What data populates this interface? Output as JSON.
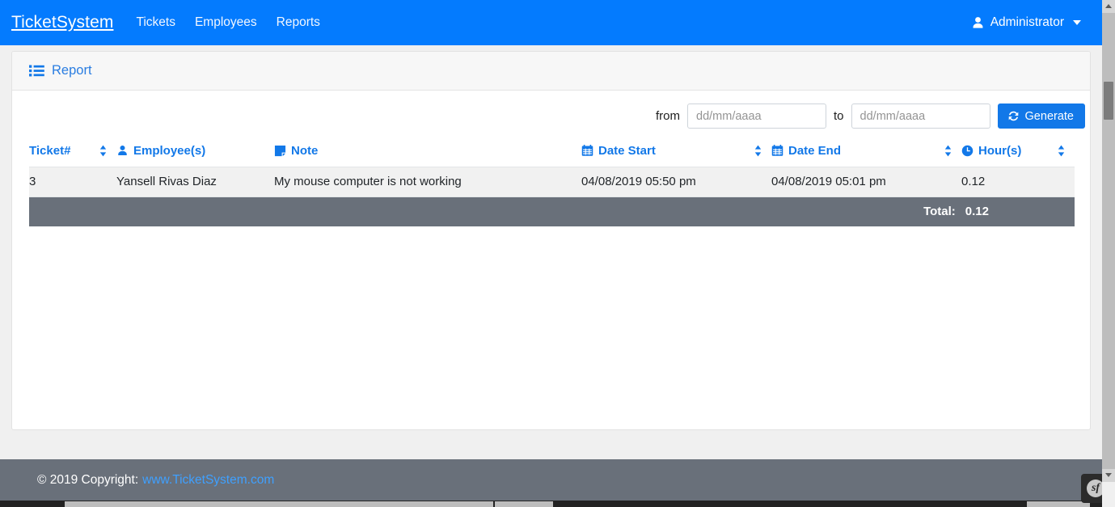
{
  "navbar": {
    "brand": "TicketSystem",
    "links": [
      {
        "label": "Tickets"
      },
      {
        "label": "Employees"
      },
      {
        "label": "Reports"
      }
    ],
    "user": {
      "label": "Administrator",
      "icon": "user-icon",
      "caret": "caret-down-icon"
    },
    "background_color": "#047bfe"
  },
  "card": {
    "header": {
      "icon": "list-ul-icon",
      "title": "Report"
    },
    "filter": {
      "from_label": "from",
      "from_placeholder": "dd/mm/aaaa",
      "from_value": "",
      "to_label": "to",
      "to_placeholder": "dd/mm/aaaa",
      "to_value": "",
      "generate_label": "Generate",
      "generate_icon": "sync-refresh-icon",
      "generate_color": "#1278e8"
    },
    "table": {
      "columns": [
        {
          "label": "Ticket#",
          "icon": null,
          "sortable": true
        },
        {
          "label": "Employee(s)",
          "icon": "user-icon",
          "sortable": false
        },
        {
          "label": "Note",
          "icon": "sticky-note-icon",
          "sortable": false
        },
        {
          "label": "Date Start",
          "icon": "calendar-icon",
          "sortable": true
        },
        {
          "label": "Date End",
          "icon": "calendar-icon",
          "sortable": true
        },
        {
          "label": "Hour(s)",
          "icon": "clock-icon",
          "sortable": true
        }
      ],
      "rows": [
        {
          "ticket": "3",
          "employees": "Yansell Rivas Diaz",
          "note": "My mouse computer is not working",
          "date_start": "04/08/2019 05:50 pm",
          "date_end": "04/08/2019 05:01 pm",
          "hours": "0.12"
        }
      ],
      "footer": {
        "total_label": "Total:",
        "total_value": "0.12",
        "background_color": "#69707a"
      },
      "header_color": "#1278e8"
    }
  },
  "footer": {
    "copyright": "© 2019 Copyright:",
    "link": "www.TicketSystem.com",
    "background_color": "#69707a"
  },
  "debug_toolbar": {
    "symfony_badge": "sf"
  }
}
